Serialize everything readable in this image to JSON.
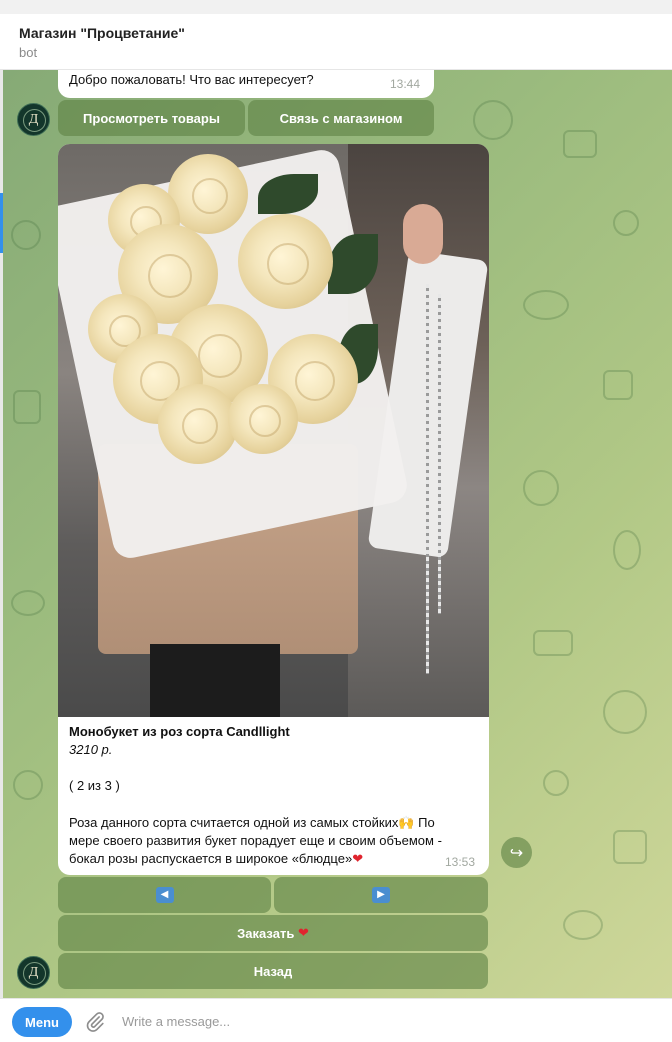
{
  "header": {
    "title": "Магазин \"Процветание\"",
    "subtitle": "bot"
  },
  "greeting": {
    "text": "Добро пожаловать! Что вас интересует?",
    "time": "13:44"
  },
  "keyboard1": {
    "browse_label": "Просмотреть товары",
    "contact_label": "Связь с магазином"
  },
  "avatar": {
    "initials": "Д"
  },
  "product": {
    "name": "Монобукет из роз сорта Candllight",
    "price": "3210 р.",
    "position": "( 2 из 3 )",
    "desc_line1": "Роза данного сорта считается одной из самых стойких",
    "desc_line1_emoji": "🙌",
    "desc_line1_end": " По",
    "desc_line2": "мере своего развития букет порадует еще и своим объемом -",
    "desc_line3": "бокал розы распускается в широкое «блюдце»",
    "desc_line3_emoji": "❤",
    "time": "13:53"
  },
  "keyboard2": {
    "prev_symbol": "◀",
    "next_symbol": "▶",
    "order_label": "Заказать",
    "order_emoji": "❤",
    "back_label": "Назад"
  },
  "forward_icon": "↪",
  "composer": {
    "menu_label": "Menu",
    "placeholder": "Write a message..."
  },
  "colors": {
    "accent": "#3390ec",
    "chat_bg": "#a5c07f",
    "button_bg": "#6f8f55"
  }
}
